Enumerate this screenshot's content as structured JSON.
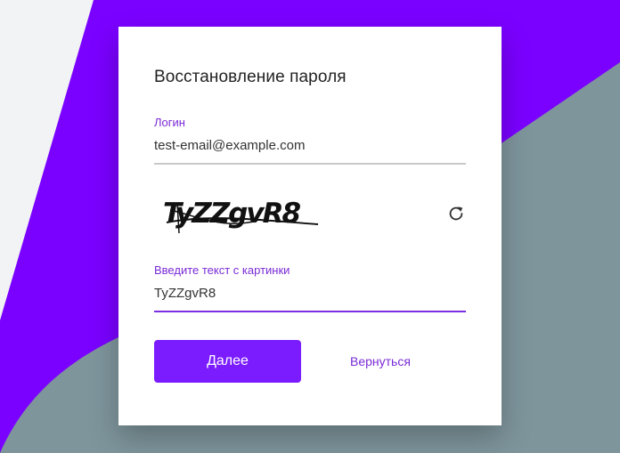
{
  "colors": {
    "accent": "#7b1cff",
    "background_purple": "#7a00ff",
    "background_gray": "#7e959c",
    "background_light": "#f1f3f4",
    "label": "#7a2bd6"
  },
  "form": {
    "title": "Восстановление пароля",
    "login_label": "Логин",
    "login_value": "test-email@example.com",
    "captcha_text": "TyZZgvR8",
    "captcha_label": "Введите текст с картинки",
    "captcha_value": "TyZZgvR8",
    "refresh_icon": "refresh-icon",
    "submit_label": "Далее",
    "back_label": "Вернуться"
  }
}
